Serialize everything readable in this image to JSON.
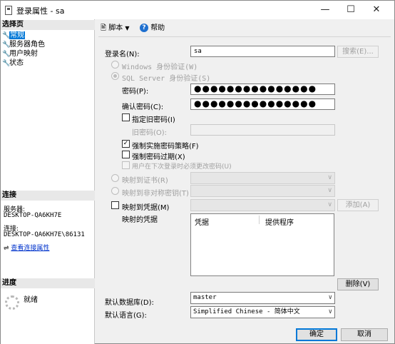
{
  "window": {
    "title": "登录属性 - sa",
    "minimize": "—",
    "maximize": "☐",
    "close": "✕"
  },
  "left": {
    "select_page_header": "选择页",
    "pages": [
      {
        "label": "常规",
        "selected": true
      },
      {
        "label": "服务器角色",
        "selected": false
      },
      {
        "label": "用户映射",
        "selected": false
      },
      {
        "label": "状态",
        "selected": false
      }
    ],
    "connection_header": "连接",
    "server_label": "服务器:",
    "server_value": "DESKTOP-QA6KH7E",
    "connection_label": "连接:",
    "connection_value": "DESKTOP-QA6KH7E\\86131",
    "view_props_link": "查看连接属性",
    "progress_header": "进度",
    "progress_status": "就绪"
  },
  "toolbar": {
    "script_label": "脚本",
    "help_label": "帮助"
  },
  "form": {
    "login_name_label": "登录名(N):",
    "login_name_value": "sa",
    "search_button": "搜索(E)...",
    "windows_auth_label": "Windows 身份验证(W)",
    "sql_auth_label": "SQL Server 身份验证(S)",
    "password_label": "密码(P):",
    "password_value": "●●●●●●●●●●●●●●●",
    "confirm_password_label": "确认密码(C):",
    "confirm_password_value": "●●●●●●●●●●●●●●●",
    "specify_old_password_label": "指定旧密码(I)",
    "old_password_label": "旧密码(O):",
    "enforce_policy_label": "强制实施密码策略(F)",
    "enforce_policy_checked": true,
    "enforce_expiration_label": "强制密码过期(X)",
    "enforce_expiration_checked": false,
    "must_change_label": "用户在下次登录时必须更改密码(U)",
    "map_certificate_label": "映射到证书(R)",
    "map_asymmetric_label": "映射到非对称密钥(T)",
    "map_credential_label": "映射到凭据(M)",
    "add_button": "添加(A)",
    "mapped_credentials_label": "映射的凭据",
    "cred_col_credential": "凭据",
    "cred_col_provider": "提供程序",
    "remove_button": "删除(V)",
    "default_db_label": "默认数据库(D):",
    "default_db_value": "master",
    "default_lang_label": "默认语言(G):",
    "default_lang_value": "Simplified Chinese - 简体中文"
  },
  "footer": {
    "ok_button": "确定",
    "cancel_button": "取消"
  },
  "colors": {
    "selection": "#0078d7",
    "link": "#0033cc"
  }
}
